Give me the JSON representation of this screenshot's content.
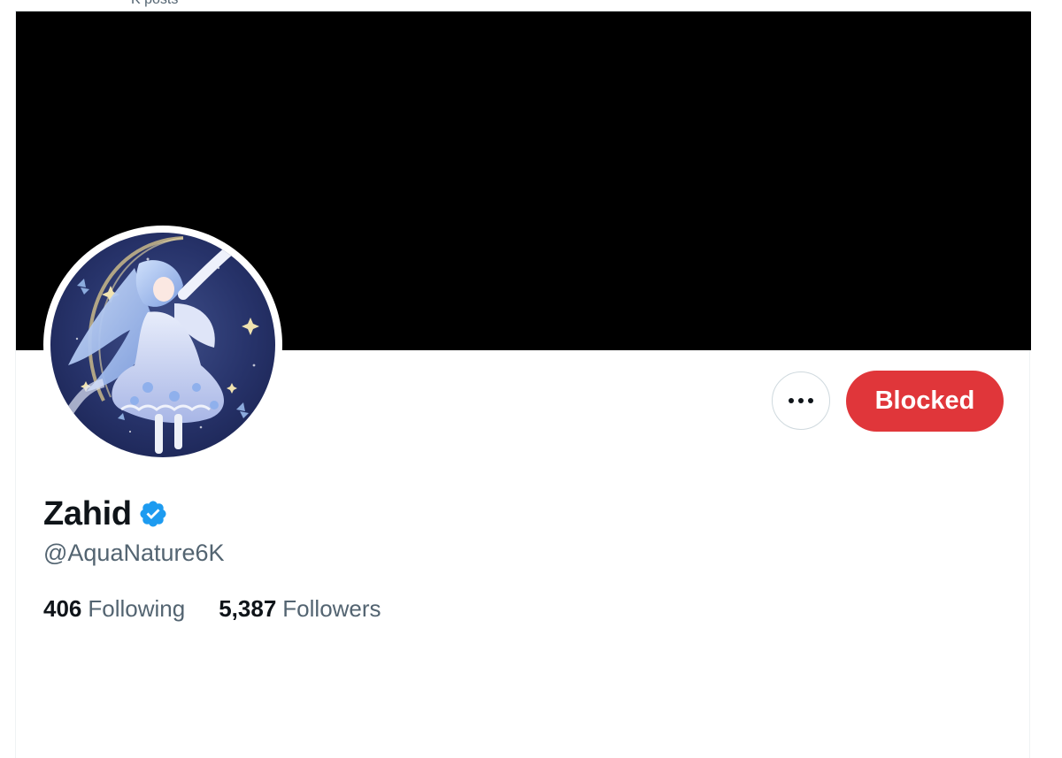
{
  "header": {
    "partial_text": "K posts"
  },
  "profile": {
    "display_name": "Zahid",
    "handle": "@AquaNature6K",
    "verified": true,
    "banner_color": "#000000",
    "action_button_label": "Blocked",
    "action_button_color": "#e0363a",
    "more_icon": "ellipsis-icon",
    "avatar_description_icon": "anime-girl-avatar"
  },
  "stats": {
    "following_count": "406",
    "following_label": "Following",
    "followers_count": "5,387",
    "followers_label": "Followers"
  },
  "colors": {
    "text_primary": "#0f1419",
    "text_secondary": "#536471",
    "verified_blue": "#1d9bf0",
    "border": "#cfd9de"
  }
}
